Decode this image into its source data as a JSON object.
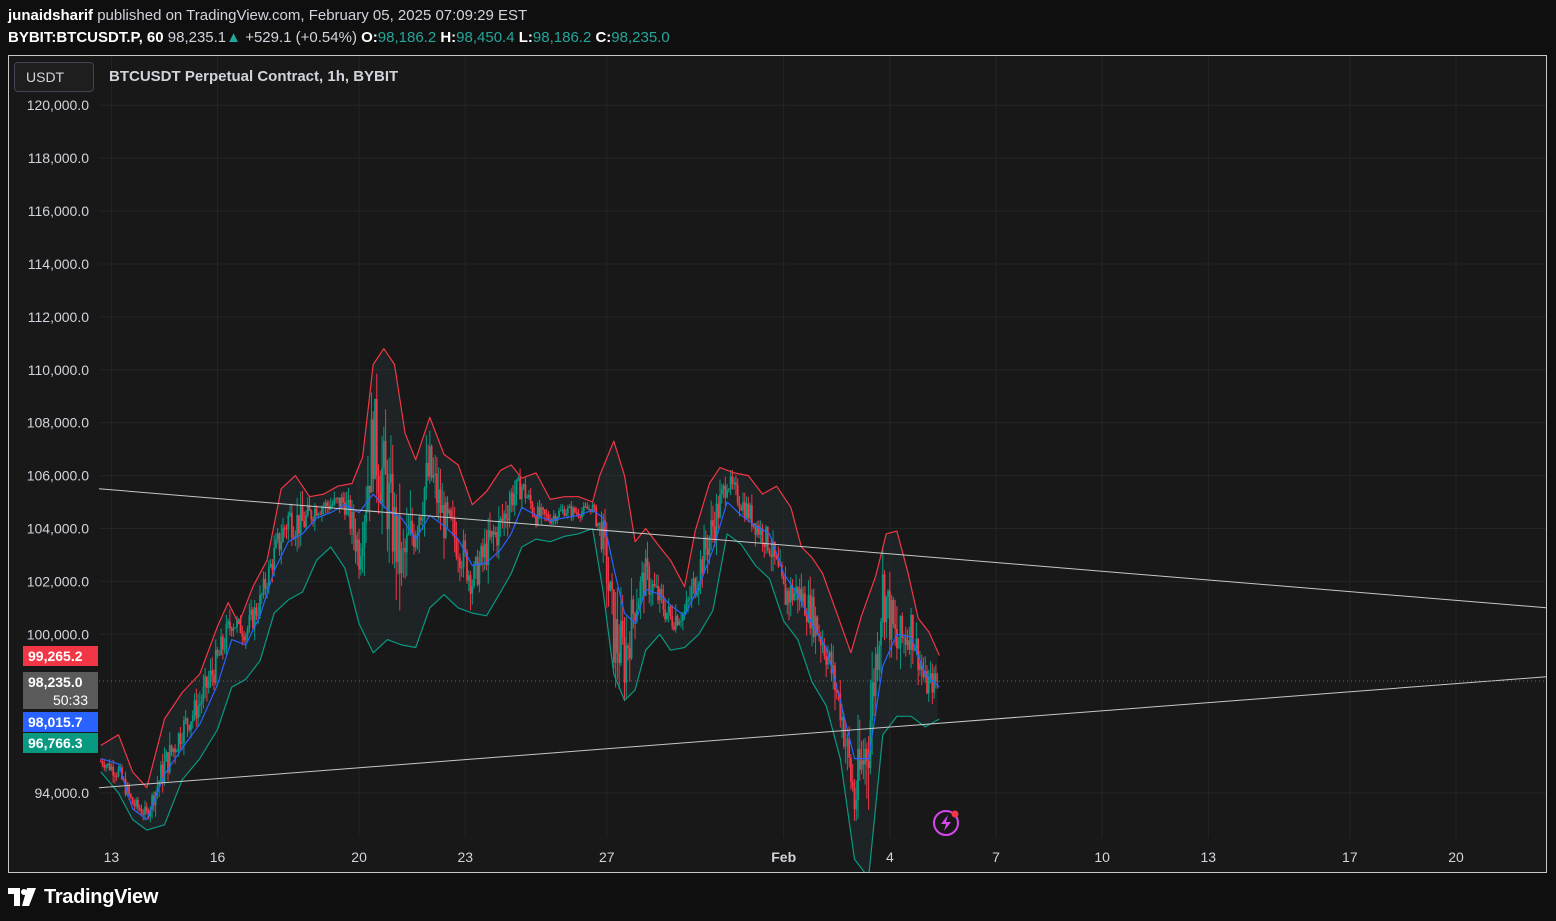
{
  "header": {
    "author": "junaidsharif",
    "published_text": "published on TradingView.com, February 05, 2025 07:09:29 EST",
    "symbol": "BYBIT:BTCUSDT.P, 60",
    "last": "98,235.1",
    "arrow": "▲",
    "change": "+529.1 (+0.54%)",
    "o_label": "O:",
    "o_value": "98,186.2",
    "h_label": "H:",
    "h_value": "98,450.4",
    "l_label": "L:",
    "l_value": "98,186.2",
    "c_label": "C:",
    "c_value": "98,235.0"
  },
  "chart": {
    "unit": "USDT",
    "title": "BTCUSDT Perpetual Contract, 1h, BYBIT",
    "price_tags": {
      "upper": "99,265.2",
      "close": "98,235.0",
      "countdown": "50:33",
      "basis": "98,015.7",
      "lower": "96,766.3"
    }
  },
  "colors": {
    "upper_band": "#f23645",
    "basis": "#2962ff",
    "lower_band": "#089981",
    "up_candle": "#089981",
    "down_candle": "#f23645",
    "trendline": "#c8c8c8",
    "lightning_icon": "#d946ef"
  },
  "icons": {
    "lightning": "lightning-icon",
    "logo": "tradingview-logo-icon"
  },
  "brand": {
    "name": "TradingView"
  },
  "chart_data": {
    "type": "candlestick",
    "title": "BTCUSDT Perpetual Contract, 1h, BYBIT",
    "y_axis": {
      "ticks": [
        {
          "value": 94000,
          "label": "94,000.0"
        },
        {
          "value": 100000,
          "label": "100,000.0"
        },
        {
          "value": 102000,
          "label": "102,000.0"
        },
        {
          "value": 104000,
          "label": "104,000.0"
        },
        {
          "value": 106000,
          "label": "106,000.0"
        },
        {
          "value": 108000,
          "label": "108,000.0"
        },
        {
          "value": 110000,
          "label": "110,000.0"
        },
        {
          "value": 112000,
          "label": "112,000.0"
        },
        {
          "value": 114000,
          "label": "114,000.0"
        },
        {
          "value": 116000,
          "label": "116,000.0"
        },
        {
          "value": 118000,
          "label": "118,000.0"
        },
        {
          "value": 120000,
          "label": "120,000.0"
        }
      ],
      "range": [
        92300,
        120500
      ]
    },
    "x_axis": {
      "ticks": [
        {
          "day": 13,
          "label": "13"
        },
        {
          "day": 16,
          "label": "16"
        },
        {
          "day": 20,
          "label": "20"
        },
        {
          "day": 23,
          "label": "23"
        },
        {
          "day": 27,
          "label": "27"
        },
        {
          "day": 32,
          "label": "Feb"
        },
        {
          "day": 35,
          "label": "4"
        },
        {
          "day": 38,
          "label": "7"
        },
        {
          "day": 41,
          "label": "10"
        },
        {
          "day": 44,
          "label": "13"
        },
        {
          "day": 48,
          "label": "17"
        },
        {
          "day": 51,
          "label": "20"
        }
      ],
      "range": [
        12.65,
        53.6
      ]
    },
    "last_price": 98235.0,
    "series": [
      {
        "name": "upper",
        "points": [
          [
            12.7,
            95800
          ],
          [
            13.2,
            96200
          ],
          [
            13.6,
            94800
          ],
          [
            14.0,
            94200
          ],
          [
            14.5,
            96800
          ],
          [
            15.0,
            97800
          ],
          [
            15.5,
            98500
          ],
          [
            16.0,
            100300
          ],
          [
            16.3,
            101200
          ],
          [
            16.6,
            100400
          ],
          [
            17.0,
            101800
          ],
          [
            17.4,
            102800
          ],
          [
            17.8,
            105500
          ],
          [
            18.2,
            106000
          ],
          [
            18.6,
            105200
          ],
          [
            19.0,
            105300
          ],
          [
            19.4,
            105600
          ],
          [
            19.8,
            105700
          ],
          [
            20.1,
            106700
          ],
          [
            20.4,
            110200
          ],
          [
            20.7,
            110800
          ],
          [
            21.0,
            110200
          ],
          [
            21.3,
            107600
          ],
          [
            21.6,
            106600
          ],
          [
            22.0,
            108200
          ],
          [
            22.4,
            106800
          ],
          [
            22.8,
            106400
          ],
          [
            23.2,
            104900
          ],
          [
            23.6,
            105400
          ],
          [
            24.0,
            106200
          ],
          [
            24.3,
            106400
          ],
          [
            24.6,
            105900
          ],
          [
            25.0,
            106100
          ],
          [
            25.4,
            105100
          ],
          [
            25.8,
            105200
          ],
          [
            26.2,
            105200
          ],
          [
            26.6,
            105000
          ],
          [
            26.8,
            106000
          ],
          [
            27.2,
            107300
          ],
          [
            27.5,
            106000
          ],
          [
            27.8,
            103500
          ],
          [
            28.1,
            104000
          ],
          [
            28.5,
            103300
          ],
          [
            28.8,
            102800
          ],
          [
            29.2,
            101800
          ],
          [
            29.5,
            103900
          ],
          [
            29.9,
            105700
          ],
          [
            30.2,
            106300
          ],
          [
            30.6,
            106100
          ],
          [
            31.0,
            106000
          ],
          [
            31.4,
            105300
          ],
          [
            31.8,
            105600
          ],
          [
            32.2,
            104800
          ],
          [
            32.5,
            103300
          ],
          [
            32.8,
            102900
          ],
          [
            33.1,
            102300
          ],
          [
            33.5,
            100800
          ],
          [
            33.9,
            99300
          ],
          [
            34.2,
            100700
          ],
          [
            34.6,
            102200
          ],
          [
            34.9,
            103800
          ],
          [
            35.2,
            103900
          ],
          [
            35.5,
            102400
          ],
          [
            35.8,
            100600
          ],
          [
            36.1,
            100100
          ],
          [
            36.4,
            99200
          ]
        ]
      },
      {
        "name": "basis",
        "points": [
          [
            12.7,
            95300
          ],
          [
            13.2,
            95100
          ],
          [
            13.6,
            93400
          ],
          [
            14.0,
            93000
          ],
          [
            14.5,
            94700
          ],
          [
            15.0,
            95700
          ],
          [
            15.5,
            96600
          ],
          [
            16.0,
            98100
          ],
          [
            16.4,
            99800
          ],
          [
            16.8,
            99600
          ],
          [
            17.2,
            100700
          ],
          [
            17.6,
            102400
          ],
          [
            18.0,
            103500
          ],
          [
            18.4,
            103800
          ],
          [
            18.8,
            104400
          ],
          [
            19.2,
            104600
          ],
          [
            19.6,
            104900
          ],
          [
            20.0,
            104600
          ],
          [
            20.4,
            105300
          ],
          [
            20.8,
            104700
          ],
          [
            21.2,
            104400
          ],
          [
            21.6,
            103600
          ],
          [
            22.0,
            104500
          ],
          [
            22.4,
            104100
          ],
          [
            22.8,
            103600
          ],
          [
            23.2,
            102600
          ],
          [
            23.6,
            102700
          ],
          [
            24.0,
            103200
          ],
          [
            24.3,
            103800
          ],
          [
            24.6,
            104800
          ],
          [
            25.0,
            104500
          ],
          [
            25.4,
            104300
          ],
          [
            25.8,
            104400
          ],
          [
            26.2,
            104500
          ],
          [
            26.6,
            104700
          ],
          [
            26.9,
            104400
          ],
          [
            27.2,
            102500
          ],
          [
            27.5,
            100800
          ],
          [
            27.8,
            100400
          ],
          [
            28.1,
            101700
          ],
          [
            28.5,
            101500
          ],
          [
            28.8,
            101100
          ],
          [
            29.2,
            100700
          ],
          [
            29.6,
            101800
          ],
          [
            30.0,
            103200
          ],
          [
            30.4,
            105000
          ],
          [
            30.8,
            104500
          ],
          [
            31.2,
            104100
          ],
          [
            31.6,
            103800
          ],
          [
            32.0,
            102300
          ],
          [
            32.4,
            101500
          ],
          [
            32.8,
            100400
          ],
          [
            33.2,
            99500
          ],
          [
            33.6,
            97500
          ],
          [
            34.0,
            95300
          ],
          [
            34.4,
            95300
          ],
          [
            34.8,
            98800
          ],
          [
            35.2,
            100000
          ],
          [
            35.6,
            99900
          ],
          [
            36.0,
            98500
          ],
          [
            36.4,
            98000
          ]
        ]
      },
      {
        "name": "lower",
        "points": [
          [
            12.7,
            94800
          ],
          [
            13.2,
            94000
          ],
          [
            13.6,
            93000
          ],
          [
            14.0,
            92600
          ],
          [
            14.5,
            92800
          ],
          [
            15.0,
            94500
          ],
          [
            15.5,
            95300
          ],
          [
            16.0,
            96400
          ],
          [
            16.4,
            98000
          ],
          [
            16.8,
            98300
          ],
          [
            17.2,
            99000
          ],
          [
            17.6,
            100800
          ],
          [
            18.0,
            101300
          ],
          [
            18.4,
            101600
          ],
          [
            18.8,
            102800
          ],
          [
            19.2,
            103300
          ],
          [
            19.6,
            102500
          ],
          [
            20.0,
            100400
          ],
          [
            20.4,
            99300
          ],
          [
            20.8,
            99800
          ],
          [
            21.2,
            99600
          ],
          [
            21.6,
            99500
          ],
          [
            22.0,
            101000
          ],
          [
            22.4,
            101500
          ],
          [
            22.8,
            101000
          ],
          [
            23.2,
            100800
          ],
          [
            23.6,
            100700
          ],
          [
            24.0,
            101600
          ],
          [
            24.3,
            102300
          ],
          [
            24.6,
            103300
          ],
          [
            25.0,
            103600
          ],
          [
            25.4,
            103500
          ],
          [
            25.8,
            103700
          ],
          [
            26.2,
            103800
          ],
          [
            26.6,
            104000
          ],
          [
            26.9,
            101600
          ],
          [
            27.2,
            98500
          ],
          [
            27.5,
            97500
          ],
          [
            27.8,
            97900
          ],
          [
            28.1,
            99400
          ],
          [
            28.5,
            100000
          ],
          [
            28.8,
            99400
          ],
          [
            29.2,
            99500
          ],
          [
            29.6,
            100000
          ],
          [
            30.0,
            100900
          ],
          [
            30.4,
            103800
          ],
          [
            30.8,
            103400
          ],
          [
            31.2,
            102600
          ],
          [
            31.6,
            102100
          ],
          [
            32.0,
            100500
          ],
          [
            32.4,
            99800
          ],
          [
            32.8,
            98200
          ],
          [
            33.2,
            97300
          ],
          [
            33.6,
            95300
          ],
          [
            34.0,
            91500
          ],
          [
            34.4,
            90800
          ],
          [
            34.8,
            96200
          ],
          [
            35.2,
            96900
          ],
          [
            35.6,
            96900
          ],
          [
            36.0,
            96500
          ],
          [
            36.4,
            96800
          ]
        ]
      },
      {
        "name": "trendline-upper",
        "points": [
          [
            12.65,
            105500
          ],
          [
            53.6,
            101000
          ]
        ]
      },
      {
        "name": "trendline-lower",
        "points": [
          [
            12.65,
            94200
          ],
          [
            53.6,
            98400
          ]
        ]
      },
      {
        "name": "price",
        "points": [
          [
            12.7,
            95200
          ],
          [
            13.2,
            94800
          ],
          [
            13.6,
            93600
          ],
          [
            14.0,
            93200
          ],
          [
            14.5,
            95000
          ],
          [
            15.0,
            96400
          ],
          [
            15.5,
            97400
          ],
          [
            16.0,
            99000
          ],
          [
            16.4,
            100500
          ],
          [
            16.8,
            100100
          ],
          [
            17.2,
            101200
          ],
          [
            17.6,
            103000
          ],
          [
            18.0,
            104400
          ],
          [
            18.4,
            104200
          ],
          [
            18.8,
            104800
          ],
          [
            19.2,
            104900
          ],
          [
            19.6,
            105000
          ],
          [
            20.0,
            103200
          ],
          [
            20.4,
            107500
          ],
          [
            20.8,
            105200
          ],
          [
            21.2,
            102500
          ],
          [
            21.6,
            104300
          ],
          [
            22.0,
            106200
          ],
          [
            22.4,
            104300
          ],
          [
            22.8,
            103500
          ],
          [
            23.2,
            102000
          ],
          [
            23.6,
            103200
          ],
          [
            24.0,
            104100
          ],
          [
            24.3,
            105200
          ],
          [
            24.6,
            105600
          ],
          [
            25.0,
            104500
          ],
          [
            25.4,
            104400
          ],
          [
            25.8,
            104700
          ],
          [
            26.2,
            104600
          ],
          [
            26.6,
            104800
          ],
          [
            26.9,
            103600
          ],
          [
            27.2,
            100000
          ],
          [
            27.5,
            99100
          ],
          [
            27.8,
            101200
          ],
          [
            28.1,
            102200
          ],
          [
            28.5,
            101300
          ],
          [
            28.8,
            100600
          ],
          [
            29.2,
            100800
          ],
          [
            29.6,
            102400
          ],
          [
            30.0,
            104100
          ],
          [
            30.4,
            105800
          ],
          [
            30.8,
            105000
          ],
          [
            31.2,
            104200
          ],
          [
            31.6,
            103400
          ],
          [
            32.0,
            101500
          ],
          [
            32.4,
            101600
          ],
          [
            32.8,
            100800
          ],
          [
            33.2,
            99400
          ],
          [
            33.6,
            97300
          ],
          [
            34.0,
            93700
          ],
          [
            34.4,
            96200
          ],
          [
            34.8,
            101800
          ],
          [
            35.2,
            99500
          ],
          [
            35.6,
            100300
          ],
          [
            36.0,
            98100
          ],
          [
            36.4,
            98235
          ]
        ]
      }
    ]
  }
}
